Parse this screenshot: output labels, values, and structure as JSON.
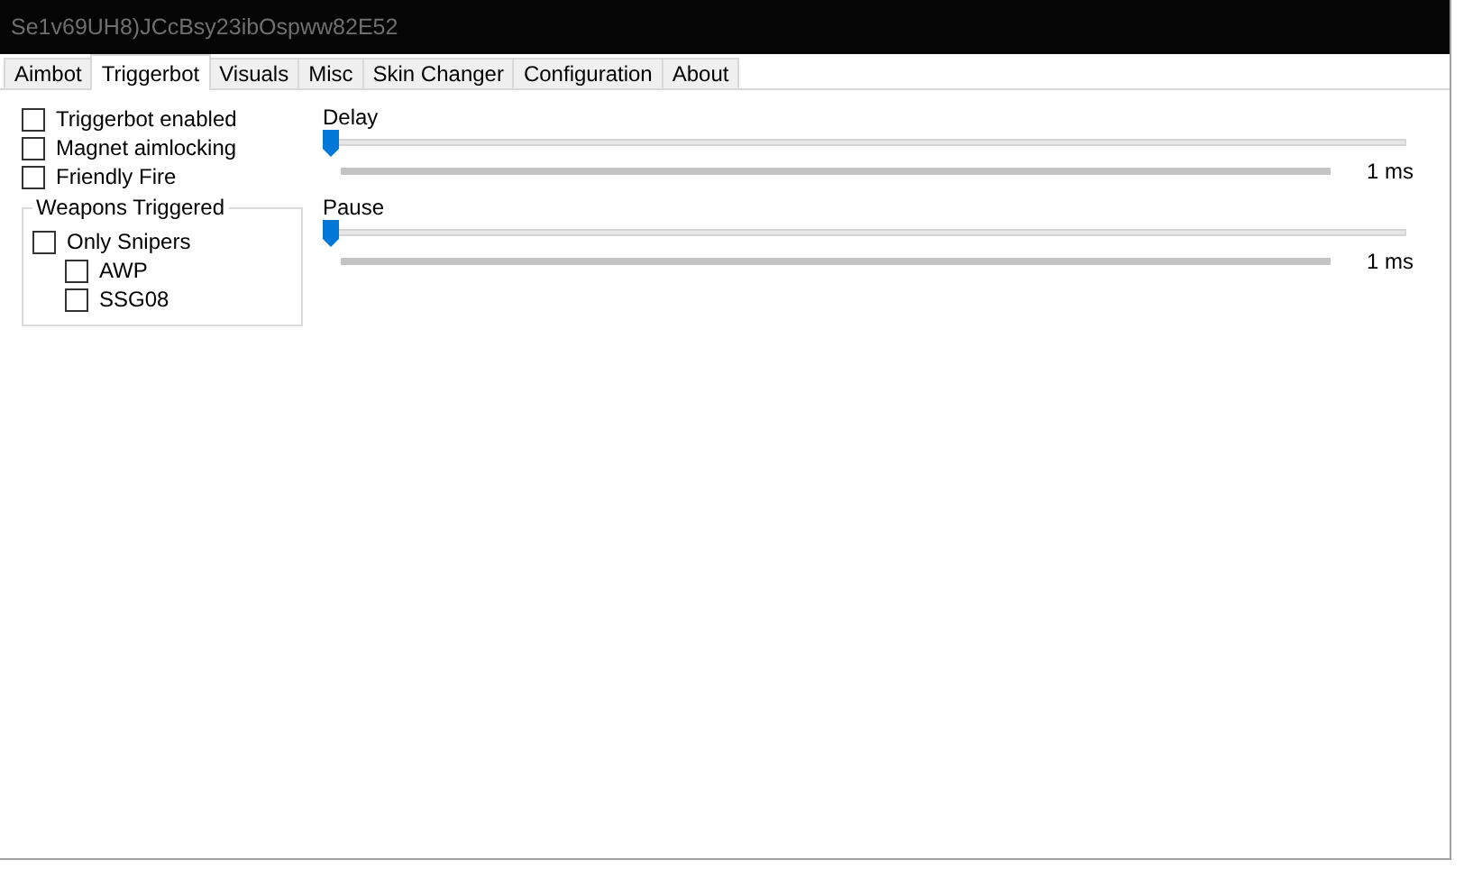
{
  "window": {
    "title": "Se1v69UH8)JCcBsy23ibOspww82E52"
  },
  "tabs": [
    {
      "label": "Aimbot",
      "selected": false
    },
    {
      "label": "Triggerbot",
      "selected": true
    },
    {
      "label": "Visuals",
      "selected": false
    },
    {
      "label": "Misc",
      "selected": false
    },
    {
      "label": "Skin Changer",
      "selected": false
    },
    {
      "label": "Configuration",
      "selected": false
    },
    {
      "label": "About",
      "selected": false
    }
  ],
  "options": [
    {
      "label": "Triggerbot enabled",
      "checked": false
    },
    {
      "label": "Magnet aimlocking",
      "checked": false
    },
    {
      "label": "Friendly Fire",
      "checked": false
    }
  ],
  "weapons_group": {
    "title": "Weapons Triggered",
    "items": [
      {
        "label": "Only Snipers",
        "checked": false,
        "children": [
          {
            "label": "AWP",
            "checked": false
          },
          {
            "label": "SSG08",
            "checked": false
          }
        ]
      }
    ]
  },
  "sliders": [
    {
      "label": "Delay",
      "level": 0,
      "reading": "1 ms"
    },
    {
      "label": "Pause",
      "level": 0,
      "reading": "1 ms"
    }
  ]
}
